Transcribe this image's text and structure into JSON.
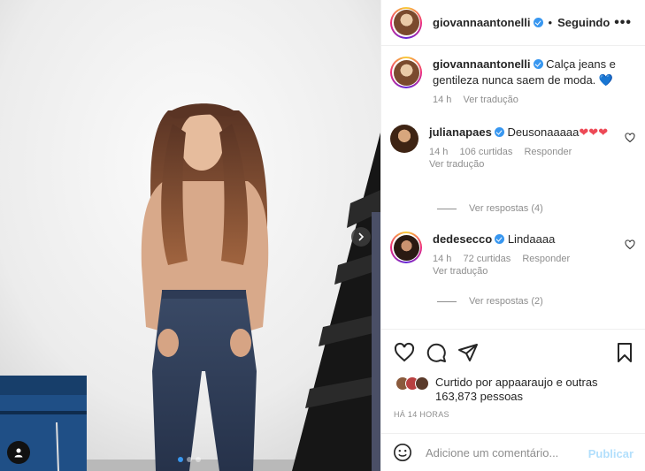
{
  "post": {
    "author": "giovannaantonelli",
    "follow_sep": "•",
    "follow_status": "Seguindo",
    "more_label": "•••"
  },
  "caption": {
    "username": "giovannaantonelli",
    "text": "Calça jeans e gentileza nunca saem de moda.",
    "emoji": "💙",
    "time": "14 h",
    "translate": "Ver tradução"
  },
  "comments": [
    {
      "username": "julianapaes",
      "text": "Deusonaaaaa",
      "hearts": "❤❤❤",
      "time": "14 h",
      "likes": "106 curtidas",
      "reply": "Responder",
      "translate": "Ver tradução",
      "view_replies": "Ver respostas (4)"
    },
    {
      "username": "dedesecco",
      "text": "Lindaaaa",
      "time": "14 h",
      "likes": "72 curtidas",
      "reply": "Responder",
      "translate": "Ver tradução",
      "view_replies": "Ver respostas (2)"
    }
  ],
  "likes": {
    "text": "Curtido por appaaraujo e outras 163,873 pessoas"
  },
  "time_ago": "HÁ 14 HORAS",
  "add_comment": {
    "placeholder": "Adicione um comentário...",
    "publish": "Publicar"
  },
  "icons": {
    "like": "heart-outline-icon",
    "comment": "comment-bubble-icon",
    "share": "paper-plane-icon",
    "save": "bookmark-icon",
    "emoji": "smiley-icon",
    "next": "chevron-right-icon",
    "user_tag": "person-icon"
  },
  "colors": {
    "verified": "#3897f0",
    "heart": "#ed4956",
    "publish_disabled": "#b2dffc"
  },
  "carousel": {
    "count": 3,
    "active": 1
  }
}
